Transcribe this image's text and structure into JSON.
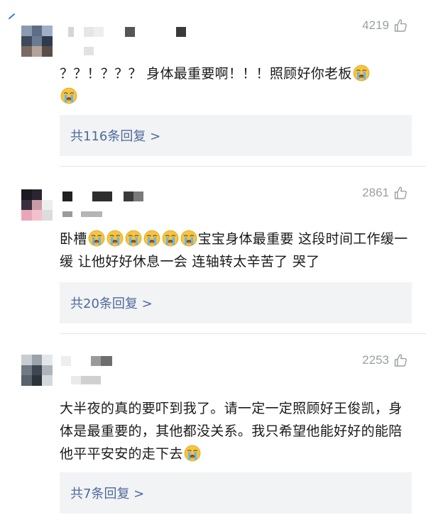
{
  "comments": [
    {
      "likes": "4219",
      "text": "？？！？？？ 身体最重要啊！！！照顾好你老板",
      "emoji_count": 2,
      "reply_label": "共116条回复 >"
    },
    {
      "likes": "2861",
      "text_prefix": "卧槽",
      "text_suffix": "宝宝身体最重要 这段时间工作缓一缓 让他好好休息一会 连轴转太辛苦了 哭了",
      "emoji_count": 6,
      "reply_label": "共20条回复 >"
    },
    {
      "likes": "2253",
      "text": "大半夜的真的要吓到我了。请一定一定照顾好王俊凯，身体是最重要的，其他都没关系。我只希望他能好好的能陪他平平安安的走下去",
      "emoji_count": 1,
      "reply_label": "共7条回复 >"
    }
  ],
  "icons": {
    "like": "thumbs-up-icon",
    "emoji": "crying-face-icon"
  },
  "colors": {
    "reply_link": "#4e6a9c",
    "reply_bg": "#f2f3f5",
    "likes_text": "#9aa0a6"
  }
}
